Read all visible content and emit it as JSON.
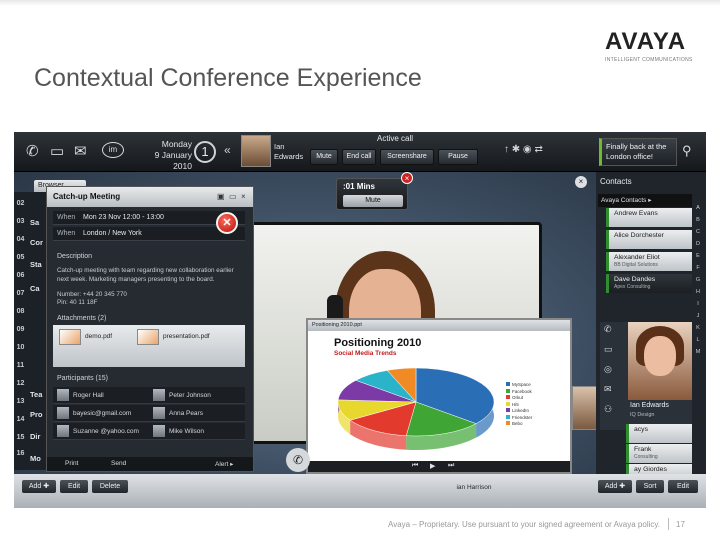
{
  "slide": {
    "title": "Contextual Conference Experience",
    "logo": "AVAYA",
    "logo_tagline": "INTELLIGENT COMMUNICATIONS",
    "footer": "Avaya – Proprietary. Use pursuant to your signed agreement or Avaya policy.",
    "page_number": "17"
  },
  "topbar": {
    "im_label": "im",
    "date_line1": "Monday",
    "date_line2": "9 January 2010",
    "clock_glyph": "1",
    "collapse_glyph": "«",
    "caller_first": "Ian",
    "caller_last": "Edwards",
    "active_call_title": "Active call",
    "buttons": {
      "mute": "Mute",
      "end_call": "End call",
      "screenshare": "Screenshare",
      "pause": "Pause"
    },
    "status_icons": "↑ ✱ ◉ ⇄",
    "notice_line1": "Finally back at the",
    "notice_line2": "London office!"
  },
  "mute_popup": {
    "timer": ":01 Mins",
    "label": "Mute",
    "close": "×"
  },
  "browser_tab": "Browser",
  "calendar": {
    "days": [
      "02",
      "03",
      "04",
      "05",
      "06",
      "07",
      "08",
      "09",
      "10",
      "11",
      "12",
      "13",
      "14",
      "15",
      "16",
      "17"
    ],
    "cards": [
      "Sa",
      "Cor",
      "Sta",
      "Ca",
      "Tea",
      "Pro",
      "Dir",
      "Mo"
    ]
  },
  "meeting": {
    "title": "Catch-up Meeting",
    "when_label": "When",
    "when_value": "Mon 23 Nov 12:00 - 13:00",
    "where_label": "When",
    "where_value": "London / New York",
    "description_heading": "Description",
    "description": "Catch-up meeting with team regarding new collaboration earlier next week. Marketing managers presenting to the board.",
    "number": "Number: +44 20 345 770",
    "pin": "Pin: 40 11 18F",
    "attachments_heading": "Attachments (2)",
    "attachments": [
      "demo.pdf",
      "presentation.pdf"
    ],
    "participants_heading": "Participants (15)",
    "participants": [
      "Roger Hall",
      "Peter Johnson",
      "bayesic@gmail.com",
      "Anna Pears",
      "Suzanne @yahoo.com",
      "Mike Wilson"
    ],
    "footer_print": "Print",
    "footer_send": "Send",
    "footer_alert": "Alert ▸"
  },
  "presentation": {
    "tab": "Positioning 2010.ppt",
    "title": "Positioning 2010",
    "subtitle": "Social Media Trends",
    "legend": [
      "MySpace",
      "Facebook",
      "Orkut",
      "Hi5",
      "LinkedIn",
      "Friendster",
      "Bebo"
    ],
    "colors": [
      "#2a6fb5",
      "#3fa535",
      "#e23b2e",
      "#e8d82d",
      "#7b3aa5",
      "#2bb3c9",
      "#f08a24"
    ]
  },
  "dock": {
    "call": "call",
    "video": "video",
    "email": "email",
    "social": "social",
    "im": "im"
  },
  "contacts": {
    "title": "Contacts",
    "close": "×",
    "dropdown": "Avaya Contacts ▸",
    "list": [
      {
        "name": "Andrew Evans",
        "org": ""
      },
      {
        "name": "Alice Dorchester",
        "org": ""
      },
      {
        "name": "Alexander Eliot",
        "org": "BB Digital Solutions"
      },
      {
        "name": "Dave Dandes",
        "org": "Apex Consulting"
      }
    ],
    "featured_name": "Ian Edwards",
    "featured_org": "IQ Design",
    "below": [
      {
        "name": "acys",
        "org": ""
      },
      {
        "name": "Frank",
        "org": "Consulting"
      },
      {
        "name": "ay Giordes",
        "org": ""
      },
      {
        "name": "ian Harrison",
        "org": ""
      }
    ],
    "alphabet": [
      "A",
      "B",
      "C",
      "D",
      "E",
      "F",
      "G",
      "H",
      "I",
      "J",
      "K",
      "L",
      "M"
    ]
  },
  "bottom": {
    "add": "Add ✚",
    "edit": "Edit",
    "delete": "Delete",
    "r_add": "Add ✚",
    "r_sort": "Sort",
    "r_edit": "Edit"
  }
}
